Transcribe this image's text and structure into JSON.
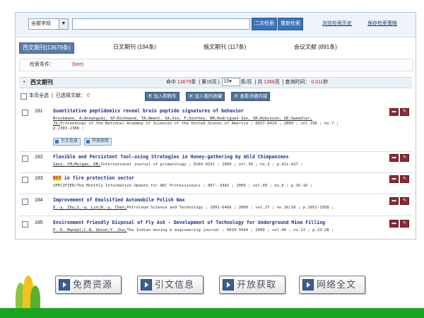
{
  "search": {
    "field_value": "全部字段",
    "query_value": "",
    "btn_secondary": "二次检索",
    "btn_new": "重新检索",
    "link_history": "浏览检索历史",
    "link_save": "保存检索策略"
  },
  "tabs": [
    {
      "label": "西文期刊(13679条)"
    },
    {
      "label": "日文期刊 (194条)"
    },
    {
      "label": "俄文期刊 (117条)"
    },
    {
      "label": "会议文献 (891条)"
    }
  ],
  "condition": {
    "label": "检索条件：",
    "value": "(bee)"
  },
  "section": {
    "title": "西文期刊",
    "hit_label": "命中",
    "hit_count": "13679",
    "hit_unit": "条",
    "page_label": "第19页",
    "page_size": "10",
    "per_page": "条/页",
    "total_label": "共",
    "total_pages": "1368",
    "total_unit": "页",
    "time_label": "查询时间：",
    "time_value": "0.011",
    "time_unit": "秒"
  },
  "toolbar": {
    "select_all": "本页全选",
    "selected_label": "已选择文献：",
    "selected_count": "0",
    "btn_cart": "加入购物车",
    "btn_fav": "加入我的收藏",
    "btn_detail": "查看详细内容"
  },
  "records": [
    {
      "num": "181",
      "title": "Quantitative peptidomics reveal brain peptide signatures of behavior",
      "authors": "Brockmann, A;Annangudi, SP;Richmond, TA;Ament, SA;Xie, F;Southey, BR;Rodriguez-Zas, SR;Robinson, GE;Sweedler,",
      "line2_author": "JV;",
      "line2_rest": "Proceedings of the National Academy of Sciences of the United States of America ; 0027-8424 ; 2009 ; vol.106 ; no.7 ;",
      "line3": "p.2383-2388 ;",
      "btn_cite": "引文信息",
      "btn_open": "开放获取"
    },
    {
      "num": "182",
      "title": "Flexible and Persistent Tool-using Strategies in Honey-gathering by Wild Chimpanzees",
      "authors": "Sanz, CM;Morgan, DB;",
      "rest": "International journal of primatology ; 0164-0291 ; 2009 ; vol.30 ; no.3 ; p.411-427 ;"
    },
    {
      "num": "183",
      "title_hl": "BEE",
      "title": " in fire protection sector",
      "rest": "SPECIFIER/The Monthly Information Update for AEC Professionals ; 007--344X ; 2009 ; vol.40 ; no.8 ; p.16-16 ;"
    },
    {
      "num": "184",
      "title": "Improvement of Emulsified Automobile Polish Wax",
      "authors": "D.-y. Zhu;S.-q. Lin;W.-y. Chen;",
      "rest": "Petroleum Science and Technology ; 1091-6466 ; 2009 ; vol.27 ; no.16/18 ; p.1951-1958 ;"
    },
    {
      "num": "185",
      "title": "Environment Friendly Disposal of Fly Ash - Development of Technology for Underground Mine Filling",
      "authors": "P. K. Mandal;C.N. Ghosh;Y. Jha;",
      "rest": "The Indian mining & engineering journal ; 0019-5944 ; 2009 ; vol.48 ; no.11 ; p.23-28 ;"
    }
  ],
  "bottom": {
    "btn_free": "免费资源",
    "btn_cite": "引文信息",
    "btn_open": "开放获取",
    "btn_fulltext": "网络全文"
  }
}
